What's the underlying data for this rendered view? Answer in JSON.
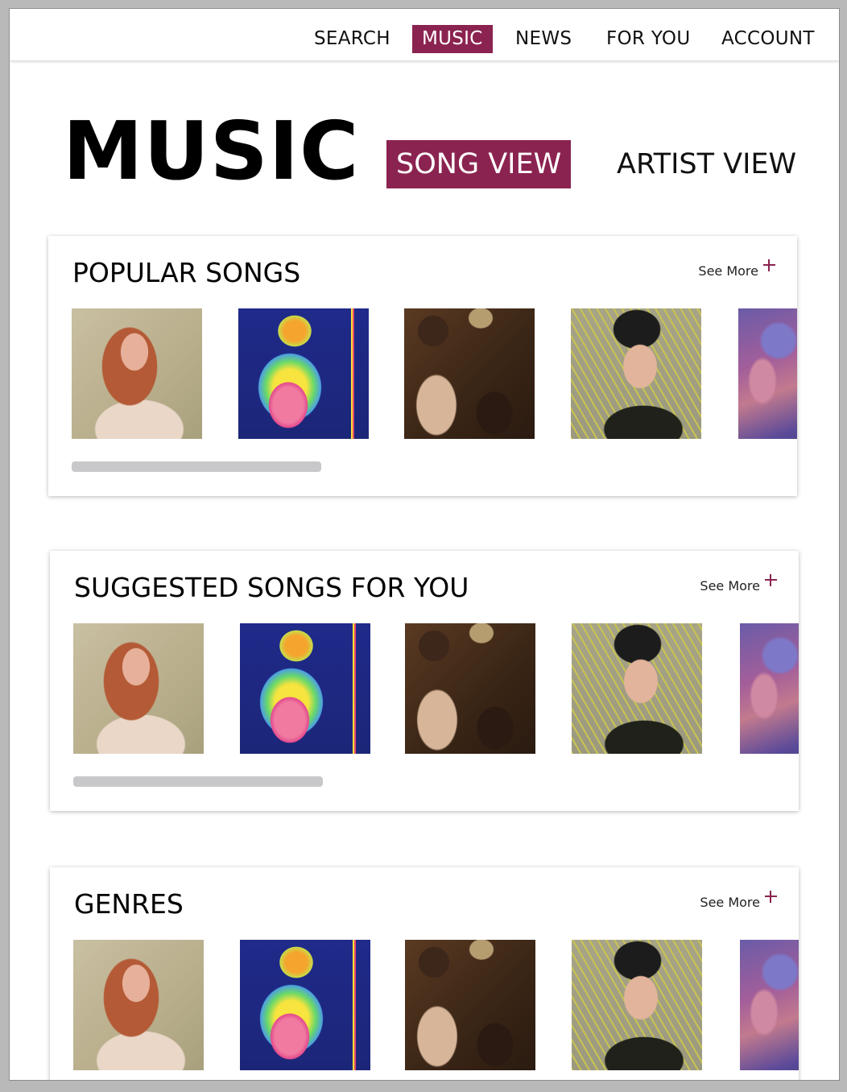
{
  "nav": {
    "items": [
      {
        "label": "SEARCH",
        "active": false
      },
      {
        "label": "MUSIC",
        "active": true
      },
      {
        "label": "NEWS",
        "active": false
      },
      {
        "label": "FOR YOU",
        "active": false
      },
      {
        "label": "ACCOUNT",
        "active": false
      }
    ]
  },
  "header": {
    "title": "MUSIC",
    "views": [
      {
        "label": "SONG VIEW",
        "active": true
      },
      {
        "label": "ARTIST VIEW",
        "active": false
      }
    ]
  },
  "sections": [
    {
      "title": "POPULAR SONGS",
      "see_more": "See More"
    },
    {
      "title": "SUGGESTED SONGS FOR YOU",
      "see_more": "See More"
    },
    {
      "title": "GENRES",
      "see_more": "See More"
    }
  ],
  "colors": {
    "accent": "#8b2350",
    "background": "#ffffff",
    "scrollbar": "#c8c8cb"
  },
  "icons": {
    "see_more": "plus-icon"
  }
}
